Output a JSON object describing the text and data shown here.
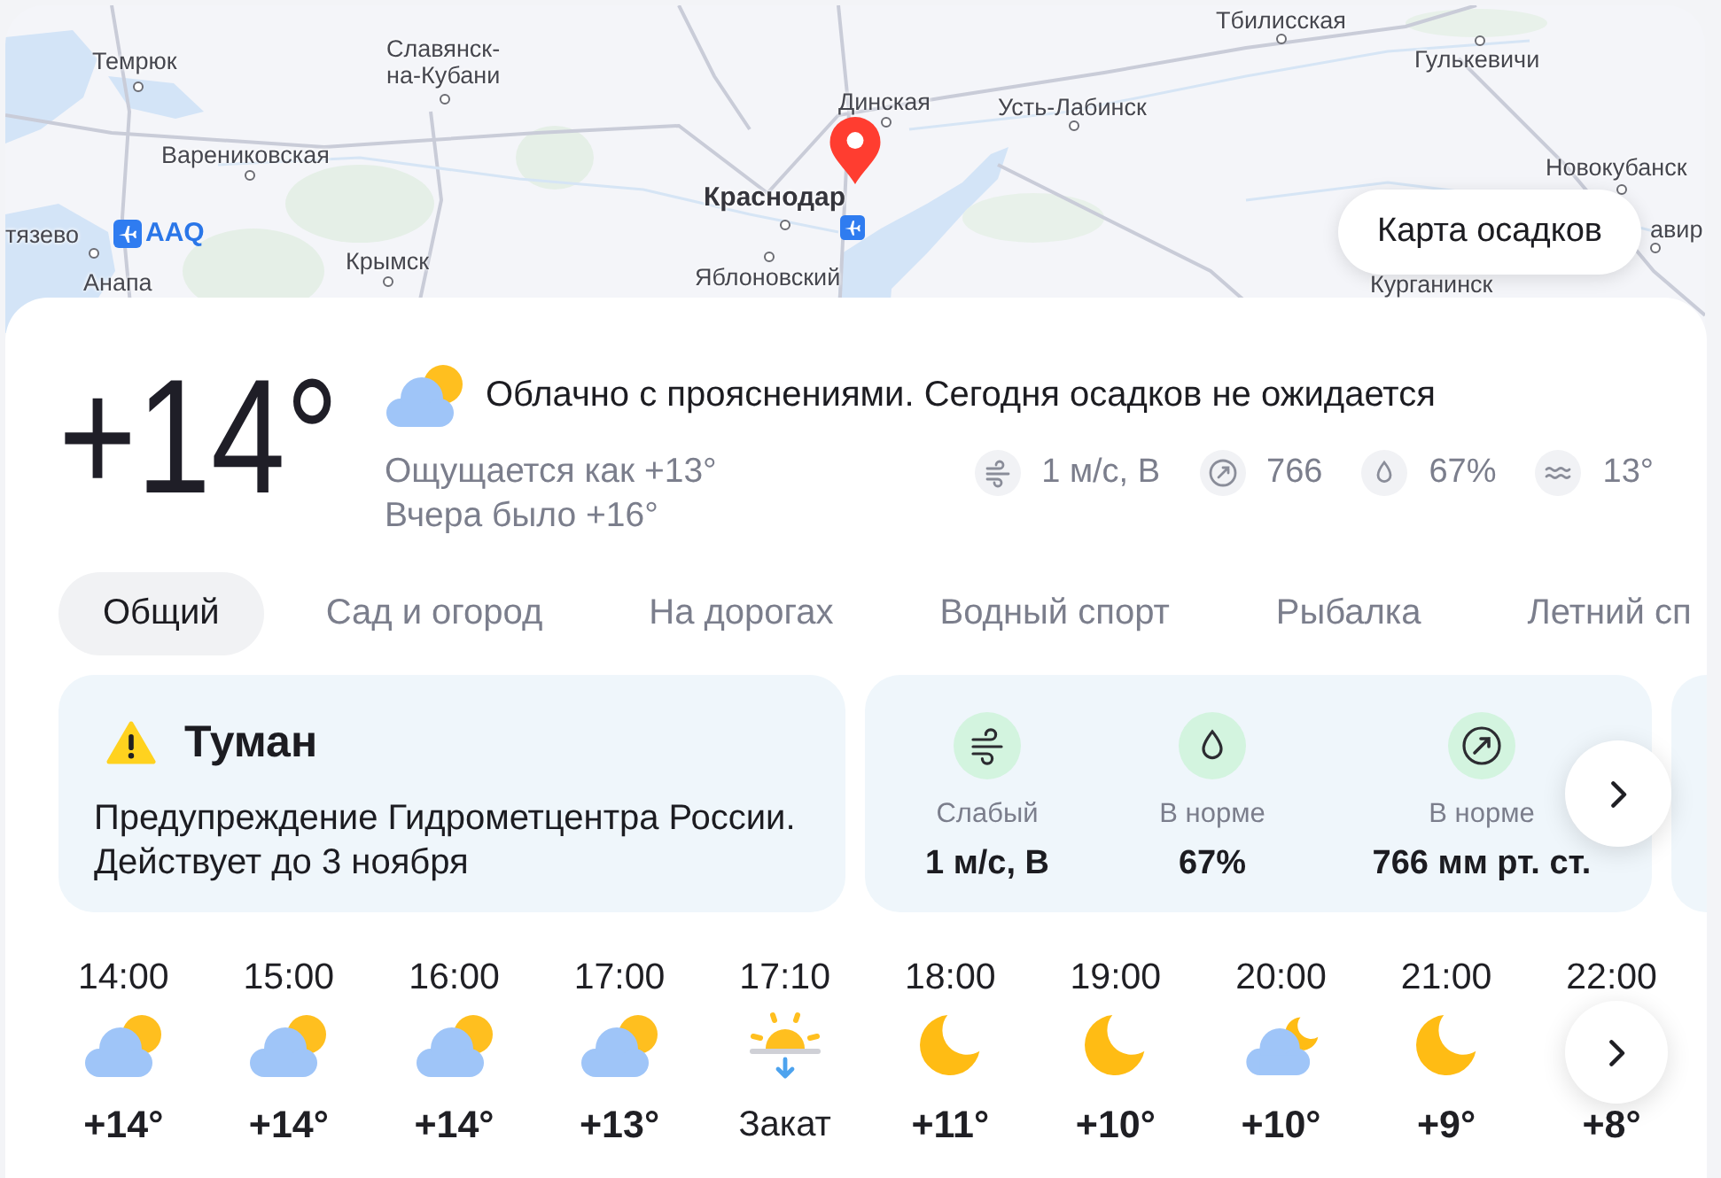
{
  "map": {
    "labels": [
      {
        "text": "Тбилисская",
        "kind": "town"
      },
      {
        "text": "Темрюк",
        "kind": "town"
      },
      {
        "text": "Славянск-на-Кубани",
        "kind": "town"
      },
      {
        "text": "Гулькевичи",
        "kind": "town"
      },
      {
        "text": "Динская",
        "kind": "town"
      },
      {
        "text": "Усть-Лабинск",
        "kind": "town"
      },
      {
        "text": "Варениковская",
        "kind": "town"
      },
      {
        "text": "Новокубанск",
        "kind": "town"
      },
      {
        "text": "Краснодар",
        "kind": "city"
      },
      {
        "text": "тязево",
        "kind": "town"
      },
      {
        "text": "AAQ",
        "kind": "airport"
      },
      {
        "text": "авир",
        "kind": "town"
      },
      {
        "text": "Анапа",
        "kind": "town"
      },
      {
        "text": "Крымск",
        "kind": "town"
      },
      {
        "text": "Яблоновский",
        "kind": "town"
      },
      {
        "text": "Курганинск",
        "kind": "town"
      }
    ],
    "precipitation_button": "Карта осадков"
  },
  "current": {
    "temperature": "+14°",
    "kind": "partly_cloudy_day",
    "condition": "Облачно с прояснениями. Сегодня осадков не ожидается",
    "feels_like": "Ощущается как +13°",
    "yesterday": "Вчера было +16°",
    "metrics": [
      {
        "kind": "wind",
        "value": "1 м/с, В"
      },
      {
        "kind": "pressure",
        "value": "766"
      },
      {
        "kind": "humidity",
        "value": "67%"
      },
      {
        "kind": "water_temperature",
        "value": "13°"
      }
    ]
  },
  "tabs": [
    {
      "label": "Общий",
      "selected": true
    },
    {
      "label": "Сад и огород",
      "selected": false
    },
    {
      "label": "На дорогах",
      "selected": false
    },
    {
      "label": "Водный спорт",
      "selected": false
    },
    {
      "label": "Рыбалка",
      "selected": false
    },
    {
      "label": "Летний сп",
      "selected": false
    }
  ],
  "warning": {
    "title": "Туман",
    "source": "Предупреждение Гидрометцентра России.",
    "valid_until": "Действует до 3 ноября"
  },
  "conditions": [
    {
      "kind": "wind",
      "label": "Слабый",
      "value": "1 м/с, В"
    },
    {
      "kind": "humidity",
      "label": "В норме",
      "value": "67%"
    },
    {
      "kind": "pressure",
      "label": "В норме",
      "value": "766 мм рт. ст."
    }
  ],
  "hourly": [
    {
      "kind": "partly_cloudy_day",
      "time": "14:00",
      "temp": "+14°"
    },
    {
      "kind": "partly_cloudy_day",
      "time": "15:00",
      "temp": "+14°"
    },
    {
      "kind": "partly_cloudy_day",
      "time": "16:00",
      "temp": "+14°"
    },
    {
      "kind": "partly_cloudy_day",
      "time": "17:00",
      "temp": "+13°"
    },
    {
      "kind": "sunset",
      "time": "17:10",
      "label": "Закат"
    },
    {
      "kind": "clear_night",
      "time": "18:00",
      "temp": "+11°"
    },
    {
      "kind": "clear_night",
      "time": "19:00",
      "temp": "+10°"
    },
    {
      "kind": "partly_cloudy_night",
      "time": "20:00",
      "temp": "+10°"
    },
    {
      "kind": "clear_night",
      "time": "21:00",
      "temp": "+9°"
    },
    {
      "time": "22:00",
      "temp": "+8°"
    }
  ]
}
